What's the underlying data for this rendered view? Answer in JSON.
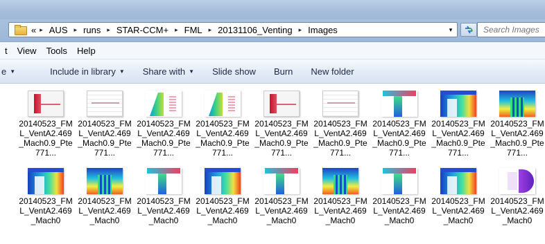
{
  "address": {
    "lead": "«",
    "crumbs": [
      "AUS",
      "runs",
      "STAR-CCM+",
      "FML",
      "20131106_Venting",
      "Images"
    ],
    "separator": "▸",
    "dropdown": "▾"
  },
  "search": {
    "placeholder": "Search Images"
  },
  "menu": {
    "items": [
      "t",
      "View",
      "Tools",
      "Help"
    ]
  },
  "toolbar": {
    "items": [
      {
        "label": "e",
        "arrow": "▼"
      },
      {
        "label": "Include in library",
        "arrow": "▼"
      },
      {
        "label": "Share with",
        "arrow": "▼"
      },
      {
        "label": "Slide show",
        "arrow": ""
      },
      {
        "label": "Burn",
        "arrow": ""
      },
      {
        "label": "New folder",
        "arrow": ""
      }
    ]
  },
  "files": [
    {
      "name": "20140523_FML_VentA2.469_Mach0.9_Pte771...",
      "thumb": "plot"
    },
    {
      "name": "20140523_FML_VentA2.469_Mach0.9_Pte771...",
      "thumb": "grid"
    },
    {
      "name": "20140523_FML_VentA2.469_Mach0.9_Pte771...",
      "thumb": "wedge"
    },
    {
      "name": "20140523_FML_VentA2.469_Mach0.9_Pte771...",
      "thumb": "wedge"
    },
    {
      "name": "20140523_FML_VentA2.469_Mach0.9_Pte771...",
      "thumb": "plot"
    },
    {
      "name": "20140523_FML_VentA2.469_Mach0.9_Pte771...",
      "thumb": "grid"
    },
    {
      "name": "20140523_FML_VentA2.469_Mach0.9_Pte771...",
      "thumb": "tee"
    },
    {
      "name": "20140523_FML_VentA2.469_Mach0.9_Pte771...",
      "thumb": "flow"
    },
    {
      "name": "20140523_FML_VentA2.469_Mach0.9_Pte771...",
      "thumb": "nozzle"
    },
    {
      "name": "20140523_FML_VentA2.469_Mach0",
      "thumb": "flow"
    },
    {
      "name": "20140523_FML_VentA2.469_Mach0",
      "thumb": "nozzle"
    },
    {
      "name": "20140523_FML_VentA2.469_Mach0",
      "thumb": "tee"
    },
    {
      "name": "20140523_FML_VentA2.469_Mach0",
      "thumb": "flow"
    },
    {
      "name": "20140523_FML_VentA2.469_Mach0",
      "thumb": "tee"
    },
    {
      "name": "20140523_FML_VentA2.469_Mach0",
      "thumb": "nozzle"
    },
    {
      "name": "20140523_FML_VentA2.469_Mach0",
      "thumb": "tee"
    },
    {
      "name": "20140523_FML_VentA2.469_Mach0",
      "thumb": "flow"
    },
    {
      "name": "20140523_FML_VentA2.469_Mach0",
      "thumb": "half"
    }
  ]
}
